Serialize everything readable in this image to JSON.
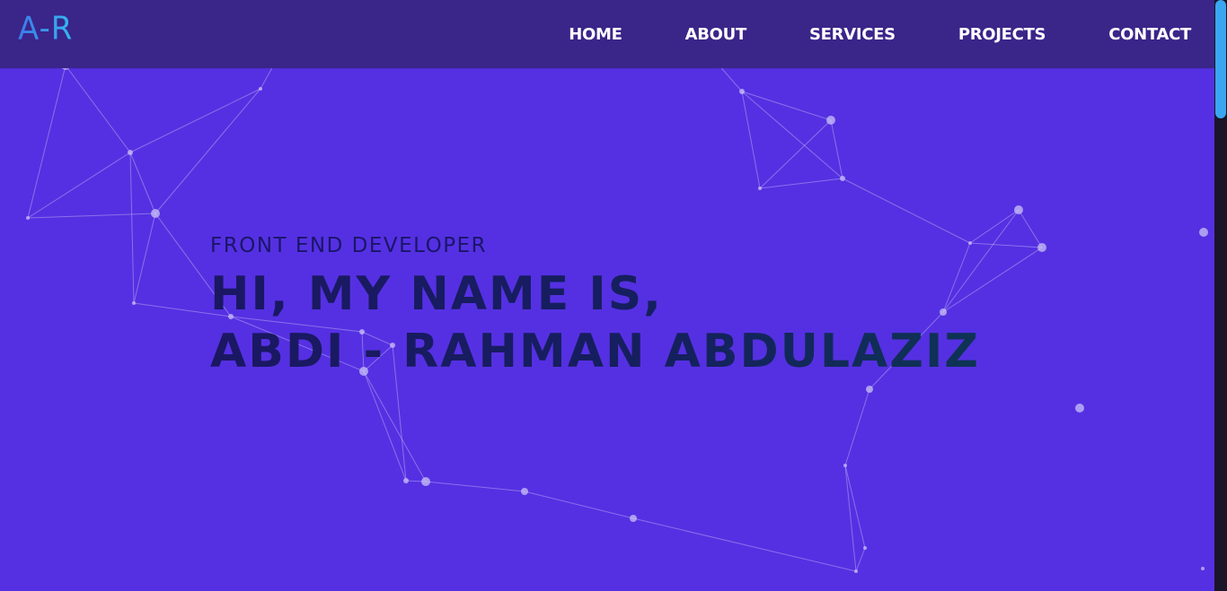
{
  "logo": {
    "text": "A-R"
  },
  "nav": {
    "items": [
      {
        "label": "HOME",
        "name": "nav-item-home"
      },
      {
        "label": "ABOUT",
        "name": "nav-item-about"
      },
      {
        "label": "SERVICES",
        "name": "nav-item-services"
      },
      {
        "label": "PROJECTS",
        "name": "nav-item-projects"
      },
      {
        "label": "CONTACT",
        "name": "nav-item-contact"
      }
    ]
  },
  "hero": {
    "subtitle": "FRONT END DEVELOPER",
    "line1": "HI, MY NAME IS,",
    "line2": "ABDI - RAHMAN ABDULAZIZ"
  },
  "colors": {
    "background": "#5530e2",
    "navbar": "#3a2589",
    "logo_gradient_start": "#3c7ae8",
    "logo_gradient_end": "#36b7f0",
    "hero_text": "#1a1668",
    "particles": "#c9c2f7",
    "scrollbar_thumb": "#3aa6f0"
  }
}
